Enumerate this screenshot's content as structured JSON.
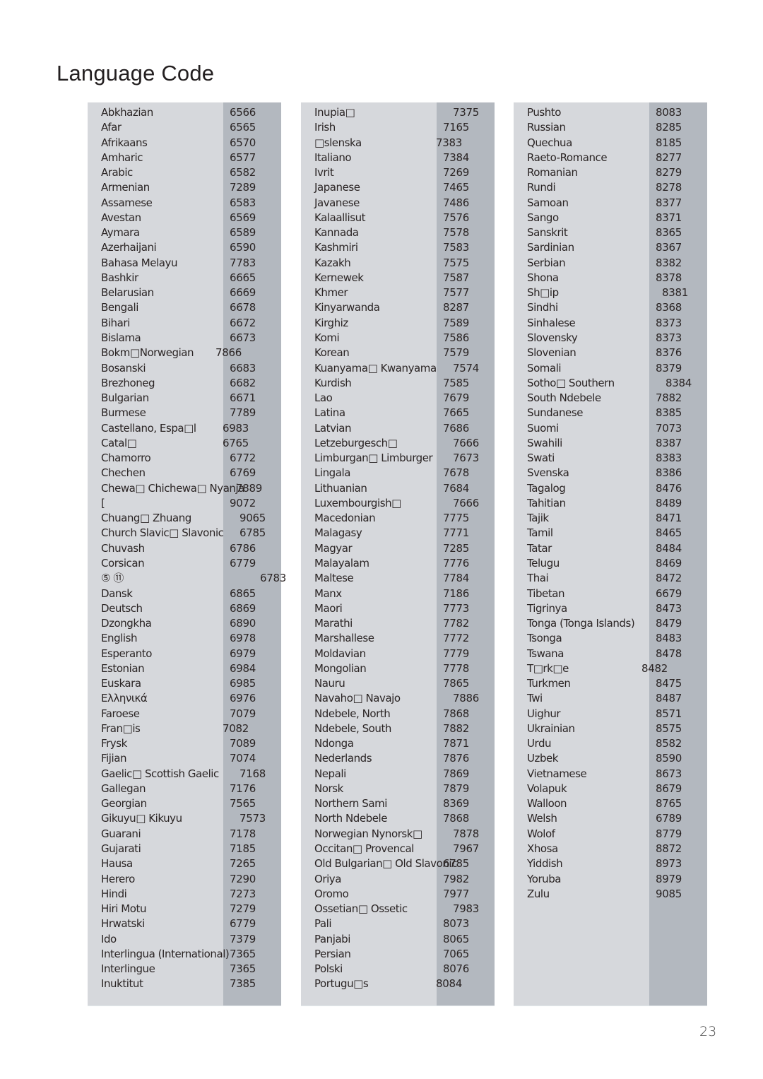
{
  "page": {
    "title": "Language Code",
    "page_number": "23"
  },
  "columns": [
    {
      "rows": [
        {
          "name": "Abkhazian",
          "code": "6566"
        },
        {
          "name": "Afar",
          "code": "6565"
        },
        {
          "name": "Afrikaans",
          "code": "6570"
        },
        {
          "name": "Amharic",
          "code": "6577"
        },
        {
          "name": "Arabic",
          "code": "6582"
        },
        {
          "name": "Armenian",
          "code": "7289"
        },
        {
          "name": "Assamese",
          "code": "6583"
        },
        {
          "name": "Avestan",
          "code": "6569"
        },
        {
          "name": "Aymara",
          "code": "6589"
        },
        {
          "name": "Azerhaijani",
          "code": "6590"
        },
        {
          "name": "Bahasa Melayu",
          "code": "7783"
        },
        {
          "name": "Bashkir",
          "code": "6665"
        },
        {
          "name": "Belarusian",
          "code": "6669"
        },
        {
          "name": "Bengali",
          "code": "6678"
        },
        {
          "name": "Bihari",
          "code": "6672"
        },
        {
          "name": "Bislama",
          "code": "6673"
        },
        {
          "name": "Bokm□Norwegian",
          "code": "7866",
          "offset": "off5"
        },
        {
          "name": "Bosanski",
          "code": "6683"
        },
        {
          "name": "Brezhoneg",
          "code": "6682"
        },
        {
          "name": "Bulgarian",
          "code": "6671"
        },
        {
          "name": "Burmese",
          "code": "7789"
        },
        {
          "name": "Castellano, Espa□l",
          "code": "6983",
          "offset": "off2"
        },
        {
          "name": "Catal□",
          "code": "6765",
          "offset": "off2"
        },
        {
          "name": "Chamorro",
          "code": "6772"
        },
        {
          "name": "Chechen",
          "code": "6769"
        },
        {
          "name": "Chewa□ Chichewa□ Nyanja",
          "code": "7889",
          "offset": "off4"
        },
        {
          "name": "  [",
          "code": "9072"
        },
        {
          "name": "Chuang□ Zhuang",
          "code": "9065",
          "offset": "off1"
        },
        {
          "name": "Church Slavic□ Slavonic",
          "code": "6785",
          "offset": "off1"
        },
        {
          "name": "Chuvash",
          "code": "6786"
        },
        {
          "name": "Corsican",
          "code": "6779"
        },
        {
          "name": "⑤  ⑪",
          "code": "6783",
          "offset": "off3"
        },
        {
          "name": "Dansk",
          "code": "6865"
        },
        {
          "name": "Deutsch",
          "code": "6869"
        },
        {
          "name": "Dzongkha",
          "code": "6890"
        },
        {
          "name": "English",
          "code": "6978"
        },
        {
          "name": "Esperanto",
          "code": "6979"
        },
        {
          "name": "Estonian",
          "code": "6984"
        },
        {
          "name": "Euskara",
          "code": "6985"
        },
        {
          "name": "Ελληνικά",
          "code": "6976"
        },
        {
          "name": "Faroese",
          "code": "7079"
        },
        {
          "name": "Fran□is",
          "code": "7082",
          "offset": "off2"
        },
        {
          "name": "Frysk",
          "code": "7089"
        },
        {
          "name": "Fijian",
          "code": "7074"
        },
        {
          "name": "Gaelic□ Scottish Gaelic",
          "code": "7168",
          "offset": "off1"
        },
        {
          "name": "Gallegan",
          "code": "7176"
        },
        {
          "name": "Georgian",
          "code": "7565"
        },
        {
          "name": "Gikuyu□ Kikuyu",
          "code": "7573",
          "offset": "off1"
        },
        {
          "name": "Guarani",
          "code": "7178"
        },
        {
          "name": "Gujarati",
          "code": "7185"
        },
        {
          "name": "Hausa",
          "code": "7265"
        },
        {
          "name": "Herero",
          "code": "7290"
        },
        {
          "name": "Hindi",
          "code": "7273"
        },
        {
          "name": "Hiri Motu",
          "code": "7279"
        },
        {
          "name": "Hrwatski",
          "code": "6779"
        },
        {
          "name": "Ido",
          "code": "7379"
        },
        {
          "name": "Interlingua (International)",
          "code": "7365"
        },
        {
          "name": "Interlingue",
          "code": "7365"
        },
        {
          "name": "Inuktitut",
          "code": "7385"
        }
      ]
    },
    {
      "rows": [
        {
          "name": "Inupia□",
          "code": "7375",
          "offset": "off1"
        },
        {
          "name": "Irish",
          "code": "7165"
        },
        {
          "name": "□slenska",
          "code": "7383",
          "offset": "off2"
        },
        {
          "name": "Italiano",
          "code": "7384"
        },
        {
          "name": "Ivrit",
          "code": "7269"
        },
        {
          "name": "Japanese",
          "code": "7465"
        },
        {
          "name": "Javanese",
          "code": "7486"
        },
        {
          "name": "Kalaallisut",
          "code": "7576"
        },
        {
          "name": "Kannada",
          "code": "7578"
        },
        {
          "name": "Kashmiri",
          "code": "7583"
        },
        {
          "name": "Kazakh",
          "code": "7575"
        },
        {
          "name": "Kernewek",
          "code": "7587"
        },
        {
          "name": "Khmer",
          "code": "7577"
        },
        {
          "name": "Kinyarwanda",
          "code": "8287"
        },
        {
          "name": "Kirghiz",
          "code": "7589"
        },
        {
          "name": "Komi",
          "code": "7586"
        },
        {
          "name": "Korean",
          "code": "7579"
        },
        {
          "name": "Kuanyama□ Kwanyama",
          "code": "7574",
          "offset": "off1"
        },
        {
          "name": "Kurdish",
          "code": "7585"
        },
        {
          "name": "Lao",
          "code": "7679"
        },
        {
          "name": "Latina",
          "code": "7665"
        },
        {
          "name": "Latvian",
          "code": "7686"
        },
        {
          "name": "Letzeburgesch□",
          "code": "7666",
          "offset": "off1"
        },
        {
          "name": "Limburgan□ Limburger",
          "code": "7673",
          "offset": "off1"
        },
        {
          "name": "Lingala",
          "code": "7678"
        },
        {
          "name": "Lithuanian",
          "code": "7684"
        },
        {
          "name": "Luxembourgish□",
          "code": "7666",
          "offset": "off1"
        },
        {
          "name": "Macedonian",
          "code": "7775"
        },
        {
          "name": "Malagasy",
          "code": "7771"
        },
        {
          "name": "Magyar",
          "code": "7285"
        },
        {
          "name": "Malayalam",
          "code": "7776"
        },
        {
          "name": "Maltese",
          "code": "7784"
        },
        {
          "name": "Manx",
          "code": "7186"
        },
        {
          "name": "Maori",
          "code": "7773"
        },
        {
          "name": "Marathi",
          "code": "7782"
        },
        {
          "name": "Marshallese",
          "code": "7772"
        },
        {
          "name": "Moldavian",
          "code": "7779"
        },
        {
          "name": "Mongolian",
          "code": "7778"
        },
        {
          "name": "Nauru",
          "code": "7865"
        },
        {
          "name": "Navaho□ Navajo",
          "code": "7886",
          "offset": "off1"
        },
        {
          "name": "Ndebele, North",
          "code": "7868"
        },
        {
          "name": "Ndebele, South",
          "code": "7882"
        },
        {
          "name": "Ndonga",
          "code": "7871"
        },
        {
          "name": "Nederlands",
          "code": "7876"
        },
        {
          "name": "Nepali",
          "code": "7869"
        },
        {
          "name": "Norsk",
          "code": "7879"
        },
        {
          "name": "Northern Sami",
          "code": "8369"
        },
        {
          "name": "North Ndebele",
          "code": "7868"
        },
        {
          "name": "Norwegian Nynorsk□",
          "code": "7878",
          "offset": "off1"
        },
        {
          "name": "Occitan□ Provencal",
          "code": "7967",
          "offset": "off1"
        },
        {
          "name": "Old Bulgarian□ Old Slavonic",
          "code": "6785"
        },
        {
          "name": "Oriya",
          "code": "7982"
        },
        {
          "name": "Oromo",
          "code": "7977"
        },
        {
          "name": "Ossetian□ Ossetic",
          "code": "7983",
          "offset": "off1"
        },
        {
          "name": "Pali",
          "code": "8073"
        },
        {
          "name": "Panjabi",
          "code": "8065"
        },
        {
          "name": "Persian",
          "code": "7065"
        },
        {
          "name": "Polski",
          "code": "8076"
        },
        {
          "name": "Portugu□s",
          "code": "8084",
          "offset": "off2"
        }
      ]
    },
    {
      "rows": [
        {
          "name": "Pushto",
          "code": "8083"
        },
        {
          "name": "Russian",
          "code": "8285"
        },
        {
          "name": "Quechua",
          "code": "8185"
        },
        {
          "name": "Raeto-Romance",
          "code": "8277"
        },
        {
          "name": "Romanian",
          "code": "8279"
        },
        {
          "name": "Rundi",
          "code": "8278"
        },
        {
          "name": "Samoan",
          "code": "8377"
        },
        {
          "name": "Sango",
          "code": "8371"
        },
        {
          "name": "Sanskrit",
          "code": "8365"
        },
        {
          "name": "Sardinian",
          "code": "8367"
        },
        {
          "name": "Serbian",
          "code": "8382"
        },
        {
          "name": "Shona",
          "code": "8378"
        },
        {
          "name": "Sh□ip",
          "code": "8381",
          "offset": "off4"
        },
        {
          "name": "Sindhi",
          "code": "8368"
        },
        {
          "name": "Sinhalese",
          "code": "8373"
        },
        {
          "name": "Slovensky",
          "code": "8373"
        },
        {
          "name": "Slovenian",
          "code": "8376"
        },
        {
          "name": "Somali",
          "code": "8379"
        },
        {
          "name": "Sotho□ Southern",
          "code": "8384",
          "offset": "off1"
        },
        {
          "name": "South Ndebele",
          "code": "7882"
        },
        {
          "name": "Sundanese",
          "code": "8385"
        },
        {
          "name": "Suomi",
          "code": "7073"
        },
        {
          "name": "Swahili",
          "code": "8387"
        },
        {
          "name": "Swati",
          "code": "8383"
        },
        {
          "name": "Svenska",
          "code": "8386"
        },
        {
          "name": "Tagalog",
          "code": "8476"
        },
        {
          "name": "Tahitian",
          "code": "8489"
        },
        {
          "name": "Tajik",
          "code": "8471"
        },
        {
          "name": "Tamil",
          "code": "8465"
        },
        {
          "name": "Tatar",
          "code": "8484"
        },
        {
          "name": "Telugu",
          "code": "8469"
        },
        {
          "name": "Thai",
          "code": "8472"
        },
        {
          "name": "Tibetan",
          "code": "6679"
        },
        {
          "name": "Tigrinya",
          "code": "8473"
        },
        {
          "name": "Tonga (Tonga Islands)",
          "code": "8479"
        },
        {
          "name": "Tsonga",
          "code": "8483"
        },
        {
          "name": "Tswana",
          "code": "8478"
        },
        {
          "name": "T□rk□e",
          "code": "8482",
          "offset": "off5"
        },
        {
          "name": "Turkmen",
          "code": "8475"
        },
        {
          "name": "Twi",
          "code": "8487"
        },
        {
          "name": "Uighur",
          "code": "8571"
        },
        {
          "name": "Ukrainian",
          "code": "8575"
        },
        {
          "name": "Urdu",
          "code": "8582"
        },
        {
          "name": "Uzbek",
          "code": "8590"
        },
        {
          "name": "Vietnamese",
          "code": "8673"
        },
        {
          "name": "Volapuk",
          "code": "8679"
        },
        {
          "name": "Walloon",
          "code": "8765"
        },
        {
          "name": "Welsh",
          "code": "6789"
        },
        {
          "name": "Wolof",
          "code": "8779"
        },
        {
          "name": "Xhosa",
          "code": "8872"
        },
        {
          "name": "Yiddish",
          "code": "8973"
        },
        {
          "name": "Yoruba",
          "code": "8979"
        },
        {
          "name": "Zulu",
          "code": "9085"
        }
      ]
    }
  ]
}
